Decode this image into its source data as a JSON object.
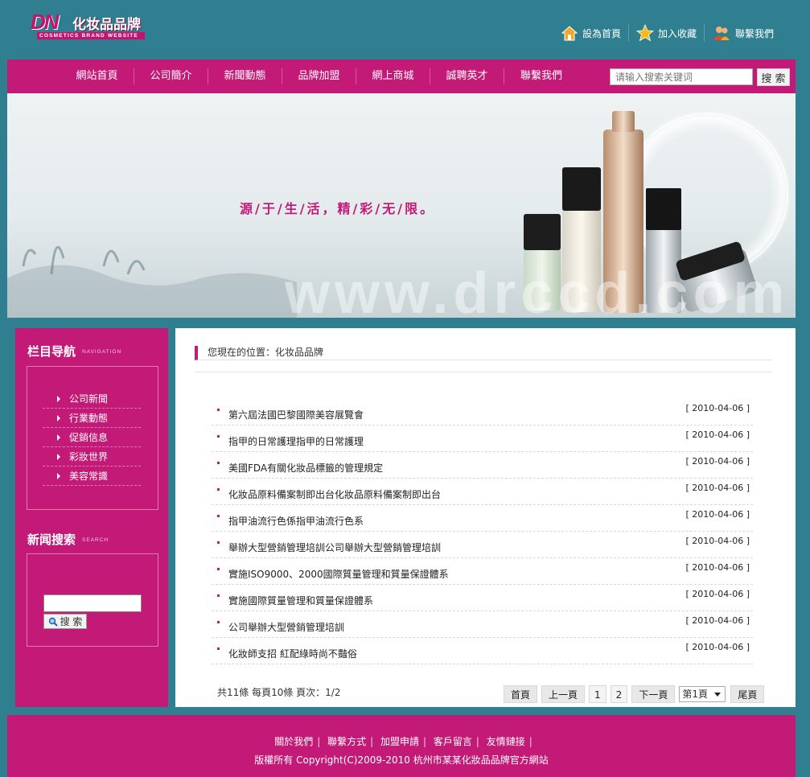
{
  "header": {
    "logo_mark": "DN",
    "logo_cn": "化妆品品牌",
    "logo_en": "COSMETICS BRAND WEBSITE",
    "top_links": [
      {
        "label": "設為首頁",
        "icon": "home-icon"
      },
      {
        "label": "加入收藏",
        "icon": "star-icon"
      },
      {
        "label": "聯繫我們",
        "icon": "users-icon"
      }
    ]
  },
  "nav": {
    "items": [
      "網站首頁",
      "公司簡介",
      "新聞動態",
      "品牌加盟",
      "網上商城",
      "誠聘英才",
      "聯繫我們"
    ],
    "search_placeholder": "请输入搜索关键词",
    "search_button": "搜 索"
  },
  "banner": {
    "slogan": "源/于/生/活，精/彩/无/限。",
    "watermark": "www.drccd.com"
  },
  "sidebar": {
    "nav_title": "栏目导航",
    "nav_title_en": "NAVIGATION",
    "categories": [
      "公司新聞",
      "行業動態",
      "促銷信息",
      "彩妝世界",
      "美容常識"
    ],
    "search_title": "新闻搜索",
    "search_title_en": "SEARCH",
    "search_button": "搜 索"
  },
  "main": {
    "breadcrumb": "您現在的位置：化妆品品牌",
    "news": [
      {
        "title": "第六屆法國巴黎國際美容展覽會",
        "date": "[ 2010-04-06 ]"
      },
      {
        "title": "指甲的日常護理指甲的日常護理",
        "date": "[ 2010-04-06 ]"
      },
      {
        "title": "美國FDA有關化妝品標籤的管理規定",
        "date": "[ 2010-04-06 ]"
      },
      {
        "title": "化妝品原料備案制即出台化妝品原料備案制即出台",
        "date": "[ 2010-04-06 ]"
      },
      {
        "title": "指甲油流行色係指甲油流行色系",
        "date": "[ 2010-04-06 ]"
      },
      {
        "title": "舉辦大型營銷管理培訓公司舉辦大型營銷管理培訓",
        "date": "[ 2010-04-06 ]"
      },
      {
        "title": "實施ISO9000、2000國際質量管理和質量保證體系",
        "date": "[ 2010-04-06 ]"
      },
      {
        "title": "實施國際質量管理和質量保證體系",
        "date": "[ 2010-04-06 ]"
      },
      {
        "title": "公司舉辦大型營銷管理培訓",
        "date": "[ 2010-04-06 ]"
      },
      {
        "title": "化妝師支招 紅配綠時尚不豔俗",
        "date": "[ 2010-04-06 ]"
      }
    ],
    "page_info": "共11條 每頁10條 頁次：1/2",
    "pager": {
      "first": "首頁",
      "prev": "上一頁",
      "p1": "1",
      "p2": "2",
      "next": "下一頁",
      "select": "第1頁",
      "last": "尾頁"
    }
  },
  "footer": {
    "links": [
      "關於我們",
      "聯繫方式",
      "加盟申請",
      "客戶留言",
      "友情鏈接"
    ],
    "separator": "|",
    "copyright": "版權所有 Copyright(C)2009-2010 杭州市某某化妝品品牌官方網站"
  },
  "colors": {
    "teal": "#2f7f90",
    "magenta": "#c21a76"
  }
}
